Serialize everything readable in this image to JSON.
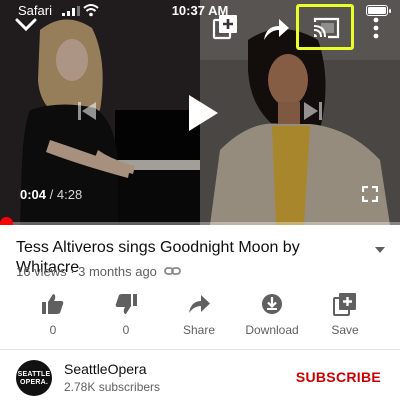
{
  "status_bar": {
    "carrier": "Safari",
    "time": "10:37 AM"
  },
  "player": {
    "current_time": "0:04",
    "separator": " / ",
    "total_time": "4:28",
    "progress_fraction": 0.015,
    "top_controls": [
      "chevron-down-icon",
      "add-to-playlist-icon",
      "share-icon",
      "cast-icon",
      "more-vert-icon"
    ],
    "center_controls": [
      "skip-previous-icon",
      "play-icon",
      "skip-next-icon"
    ],
    "highlight_color": "#eaff2a",
    "accent_color": "#ff0000"
  },
  "video": {
    "title": "Tess Altiveros sings Goodnight Moon by Whitacre",
    "meta": "16 views · 3 months ago"
  },
  "actions": [
    {
      "icon": "thumbs-up-icon",
      "label": "0"
    },
    {
      "icon": "thumbs-down-icon",
      "label": "0"
    },
    {
      "icon": "share-icon",
      "label": "Share"
    },
    {
      "icon": "download-icon",
      "label": "Download"
    },
    {
      "icon": "save-icon",
      "label": "Save"
    }
  ],
  "channel": {
    "avatar_text_1": "SEATTLE",
    "avatar_text_2": "OPERA.",
    "name": "SeattleOpera",
    "subscribers": "2.78K subscribers",
    "subscribe_label": "SUBSCRIBE",
    "subscribe_color": "#cc0000"
  }
}
